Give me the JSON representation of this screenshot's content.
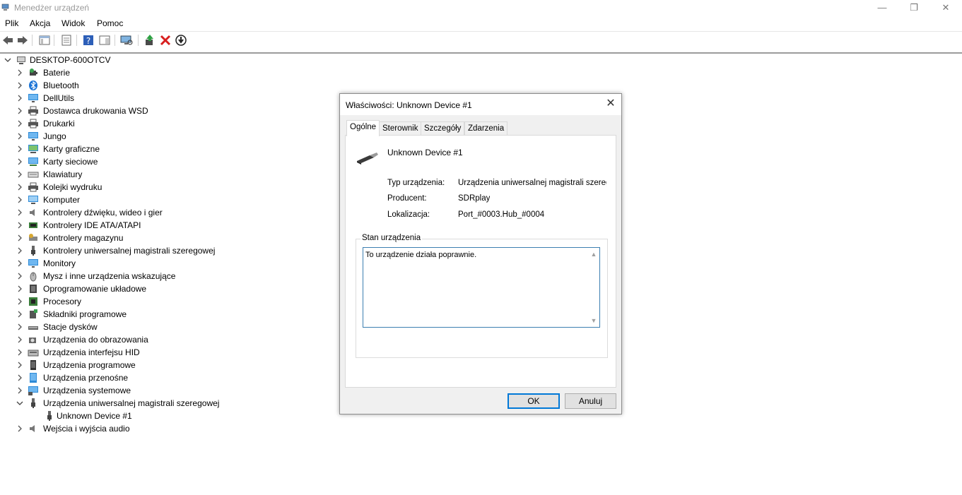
{
  "window": {
    "title": "Menedżer urządzeń",
    "controls": {
      "minimize": "—",
      "restore": "❐",
      "close": "✕"
    }
  },
  "menu": [
    "Plik",
    "Akcja",
    "Widok",
    "Pomoc"
  ],
  "toolbar": {
    "icons": [
      "back-icon",
      "forward-icon",
      "show-hide-console-tree-icon",
      "properties-icon",
      "help-icon",
      "action-pane-icon",
      "scan-hardware-icon",
      "update-driver-icon",
      "uninstall-icon",
      "disable-device-icon"
    ]
  },
  "tree": {
    "root": "DESKTOP-600OTCV",
    "items": [
      {
        "label": "Baterie",
        "icon": "battery-icon"
      },
      {
        "label": "Bluetooth",
        "icon": "bluetooth-icon"
      },
      {
        "label": "DellUtils",
        "icon": "monitor-icon"
      },
      {
        "label": "Dostawca drukowania WSD",
        "icon": "printer-icon"
      },
      {
        "label": "Drukarki",
        "icon": "printer-icon"
      },
      {
        "label": "Jungo",
        "icon": "monitor-icon"
      },
      {
        "label": "Karty graficzne",
        "icon": "display-adapter-icon"
      },
      {
        "label": "Karty sieciowe",
        "icon": "network-icon"
      },
      {
        "label": "Klawiatury",
        "icon": "keyboard-icon"
      },
      {
        "label": "Kolejki wydruku",
        "icon": "printer-icon"
      },
      {
        "label": "Komputer",
        "icon": "computer-icon"
      },
      {
        "label": "Kontrolery dźwięku, wideo i gier",
        "icon": "speaker-icon"
      },
      {
        "label": "Kontrolery IDE ATA/ATAPI",
        "icon": "ide-icon"
      },
      {
        "label": "Kontrolery magazynu",
        "icon": "storage-icon"
      },
      {
        "label": "Kontrolery uniwersalnej magistrali szeregowej",
        "icon": "usb-icon"
      },
      {
        "label": "Monitory",
        "icon": "monitor-icon"
      },
      {
        "label": "Mysz i inne urządzenia wskazujące",
        "icon": "mouse-icon"
      },
      {
        "label": "Oprogramowanie układowe",
        "icon": "firmware-icon"
      },
      {
        "label": "Procesory",
        "icon": "processor-icon"
      },
      {
        "label": "Składniki programowe",
        "icon": "software-component-icon"
      },
      {
        "label": "Stacje dysków",
        "icon": "disk-drive-icon"
      },
      {
        "label": "Urządzenia do obrazowania",
        "icon": "camera-icon"
      },
      {
        "label": "Urządzenia interfejsu HID",
        "icon": "hid-icon"
      },
      {
        "label": "Urządzenia programowe",
        "icon": "software-device-icon"
      },
      {
        "label": "Urządzenia przenośne",
        "icon": "portable-device-icon"
      },
      {
        "label": "Urządzenia systemowe",
        "icon": "system-icon"
      },
      {
        "label": "Urządzenia uniwersalnej magistrali szeregowej",
        "icon": "usb-icon",
        "expanded": true
      },
      {
        "label": "Unknown Device #1",
        "icon": "usb-icon",
        "child": true
      },
      {
        "label": "Wejścia i wyjścia audio",
        "icon": "speaker-icon"
      }
    ]
  },
  "dialog": {
    "title": "Właściwości: Unknown Device #1",
    "close": "✕",
    "tabs": [
      "Ogólne",
      "Sterownik",
      "Szczegóły",
      "Zdarzenia"
    ],
    "active_tab": "Ogólne",
    "device_name": "Unknown Device #1",
    "properties": [
      {
        "label": "Typ urządzenia:",
        "value": "Urządzenia uniwersalnej magistrali szeregowej"
      },
      {
        "label": "Producent:",
        "value": "SDRplay"
      },
      {
        "label": "Lokalizacja:",
        "value": "Port_#0003.Hub_#0004"
      }
    ],
    "status_group_label": "Stan urządzenia",
    "status_text": "To urządzenie działa poprawnie.",
    "ok_label": "OK",
    "cancel_label": "Anuluj"
  }
}
